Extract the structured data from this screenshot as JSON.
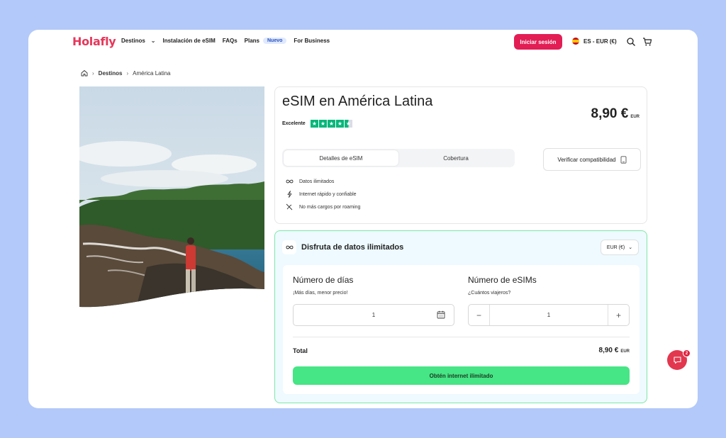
{
  "header": {
    "logo": "Holafly",
    "nav": [
      {
        "label": "Destinos",
        "has_dropdown": true
      },
      {
        "label": "Instalación de eSIM"
      },
      {
        "label": "FAQs"
      },
      {
        "label": "Plans",
        "badge": "Nuevo"
      },
      {
        "label": "For Business"
      }
    ],
    "login_label": "Iniciar sesión",
    "locale_label": "ES - EUR (€)",
    "search_icon": "search-icon",
    "cart_icon": "cart-icon"
  },
  "breadcrumb": {
    "home_icon": "home-icon",
    "items": [
      "Destinos",
      "América Latina"
    ]
  },
  "hero_image": "coastline-with-palm-trees-and-traveler",
  "product": {
    "title": "eSIM en América Latina",
    "rating_label": "Excelente",
    "rating_stars": 4.5,
    "price": "8,90 €",
    "price_currency": "EUR",
    "tabs": [
      {
        "label": "Detalles de eSIM",
        "active": true
      },
      {
        "label": "Cobertura",
        "active": false
      }
    ],
    "verify_label": "Verificar compatibilidad",
    "features": [
      {
        "icon": "infinity-icon",
        "label": "Datos ilimitados"
      },
      {
        "icon": "lightning-icon",
        "label": "Internet rápido y confiable"
      },
      {
        "icon": "no-roaming-icon",
        "label": "No más cargos por roaming"
      }
    ]
  },
  "booking": {
    "title": "Disfruta de datos ilimitados",
    "currency": "EUR (€)",
    "days_title": "Número de días",
    "days_sub": "¡Más días, menor precio!",
    "days_value": "1",
    "esims_title": "Número de eSIMs",
    "esims_sub": "¿Cuántos viajeros?",
    "esims_value": "1",
    "minus_label": "−",
    "plus_label": "+",
    "total_label": "Total",
    "total_price": "8,90 €",
    "total_currency": "EUR",
    "cta_label": "Obtén internet ilimitado"
  },
  "chat": {
    "unread_count": "2"
  },
  "colors": {
    "brand": "#e6375a",
    "login_button": "#e21e55",
    "cta": "#46e585",
    "trustpilot": "#00b67a",
    "page_background": "#b3c9f9",
    "booking_border": "#7ee7a8"
  }
}
